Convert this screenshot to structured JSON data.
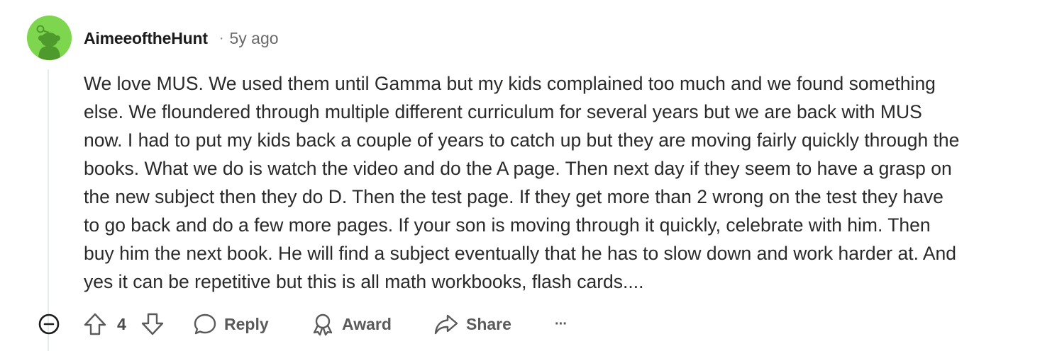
{
  "comment": {
    "username": "AimeeoftheHunt",
    "separator": "·",
    "timestamp": "5y ago",
    "body_lines": [
      "We love MUS. We used them until Gamma but my kids complained too much and we found something",
      "else. We floundered through multiple different curriculum for several years but we are back with MUS",
      "now. I had to put my kids back a couple of years to catch up but they are moving fairly quickly through the",
      "books. What we do is watch the video and do the A page. Then next day if they seem to have a grasp on",
      "the new subject then they do D. Then the test page. If they get more than 2 wrong on the test they have",
      "to go back and do a few more pages. If your son is moving through it quickly, celebrate with him. Then",
      "buy him the next book. He will find a subject eventually that he has to slow down and work harder at. And",
      "yes it can be repetitive but this is all math workbooks, flash cards...."
    ],
    "vote_count": "4"
  },
  "actions": {
    "reply_label": "Reply",
    "award_label": "Award",
    "share_label": "Share",
    "more_label": "···"
  },
  "icons": {
    "collapse": "collapse-minus-icon",
    "upvote": "upvote-arrow-icon",
    "downvote": "downvote-arrow-icon",
    "reply": "speech-bubble-icon",
    "award": "award-ribbon-icon",
    "share": "share-arrow-icon",
    "more": "ellipsis-icon",
    "avatar": "snoo-avatar"
  },
  "colors": {
    "avatar_bg": "#7ed64f",
    "avatar_figure": "#4f9a2c",
    "icon_gray": "#5a5a5a",
    "thread_line": "#e5ebee"
  }
}
